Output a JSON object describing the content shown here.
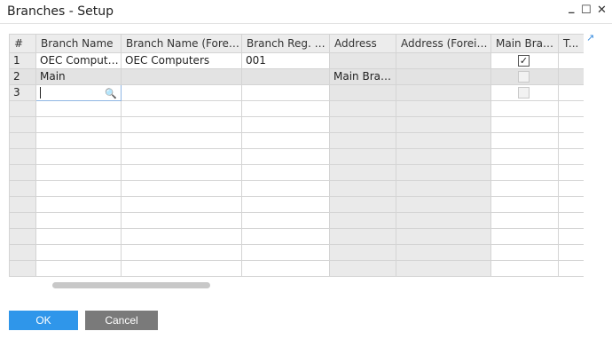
{
  "window": {
    "title": "Branches - Setup",
    "minimize_glyph": "_",
    "maximize_glyph": "☐",
    "close_glyph": "✕"
  },
  "grid": {
    "columns": [
      "#",
      "Branch Name",
      "Branch Name (Foreign)",
      "Branch Reg. No.",
      "Address",
      "Address (Foreign)",
      "Main Branch",
      "T..."
    ],
    "rows": [
      {
        "num": "1",
        "branch_name": "OEC Computers",
        "branch_name_foreign": "OEC Computers",
        "reg_no": "001",
        "address": "",
        "address_foreign": "",
        "main_branch": true
      },
      {
        "num": "2",
        "branch_name": "Main",
        "branch_name_foreign": "",
        "reg_no": "",
        "address": "Main Branch",
        "address_foreign": "",
        "main_branch": false
      },
      {
        "num": "3",
        "branch_name": "",
        "branch_name_foreign": "",
        "reg_no": "",
        "address": "",
        "address_foreign": "",
        "main_branch": false
      }
    ],
    "checkmark_glyph": "✓",
    "lookup_icon": "magnifier-icon",
    "expand_icon": "expand-arrow-icon"
  },
  "footer": {
    "ok_label": "OK",
    "cancel_label": "Cancel"
  },
  "colors": {
    "ok_button": "#2f96ea",
    "cancel_button": "#7a7a7a",
    "accent": "#3b8ee0"
  }
}
